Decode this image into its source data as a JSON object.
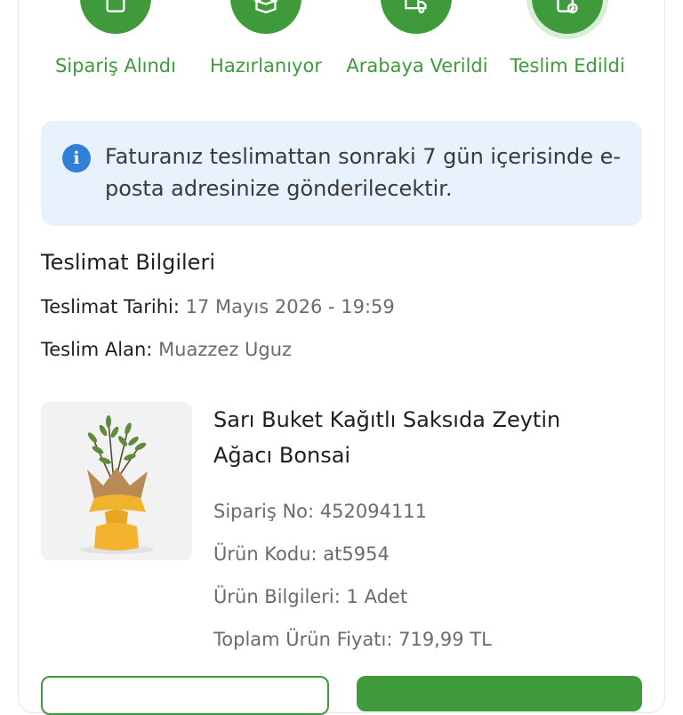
{
  "steps": [
    {
      "label": "Sipariş Alındı",
      "icon": "box-icon"
    },
    {
      "label": "Hazırlanıyor",
      "icon": "open-box-icon"
    },
    {
      "label": "Arabaya Verildi",
      "icon": "truck-icon"
    },
    {
      "label": "Teslim Edildi",
      "icon": "delivered-check-icon"
    }
  ],
  "colors": {
    "accent": "#3e9a3a",
    "info_bg": "#e8f2fc",
    "info_icon": "#2f80d6"
  },
  "info": {
    "text": "Faturanız teslimattan sonraki 7 gün içerisinde e-posta adresinize gönderilecektir."
  },
  "delivery": {
    "title": "Teslimat Bilgileri",
    "date_label": "Teslimat Tarihi:",
    "date_value": "17 Mayıs 2026 - 19:59",
    "receiver_label": "Teslim Alan:",
    "receiver_value": "Muazzez Uguz"
  },
  "product": {
    "name": "Sarı Buket Kağıtlı Saksıda Zeytin Ağacı Bonsai",
    "order_no_label": "Sipariş No:",
    "order_no": "452094111",
    "code_label": "Ürün Kodu:",
    "code": "at5954",
    "info_label": "Ürün Bilgileri:",
    "info": "1 Adet",
    "price_label": "Toplam Ürün Fiyatı:",
    "price": "719,99 TL"
  }
}
